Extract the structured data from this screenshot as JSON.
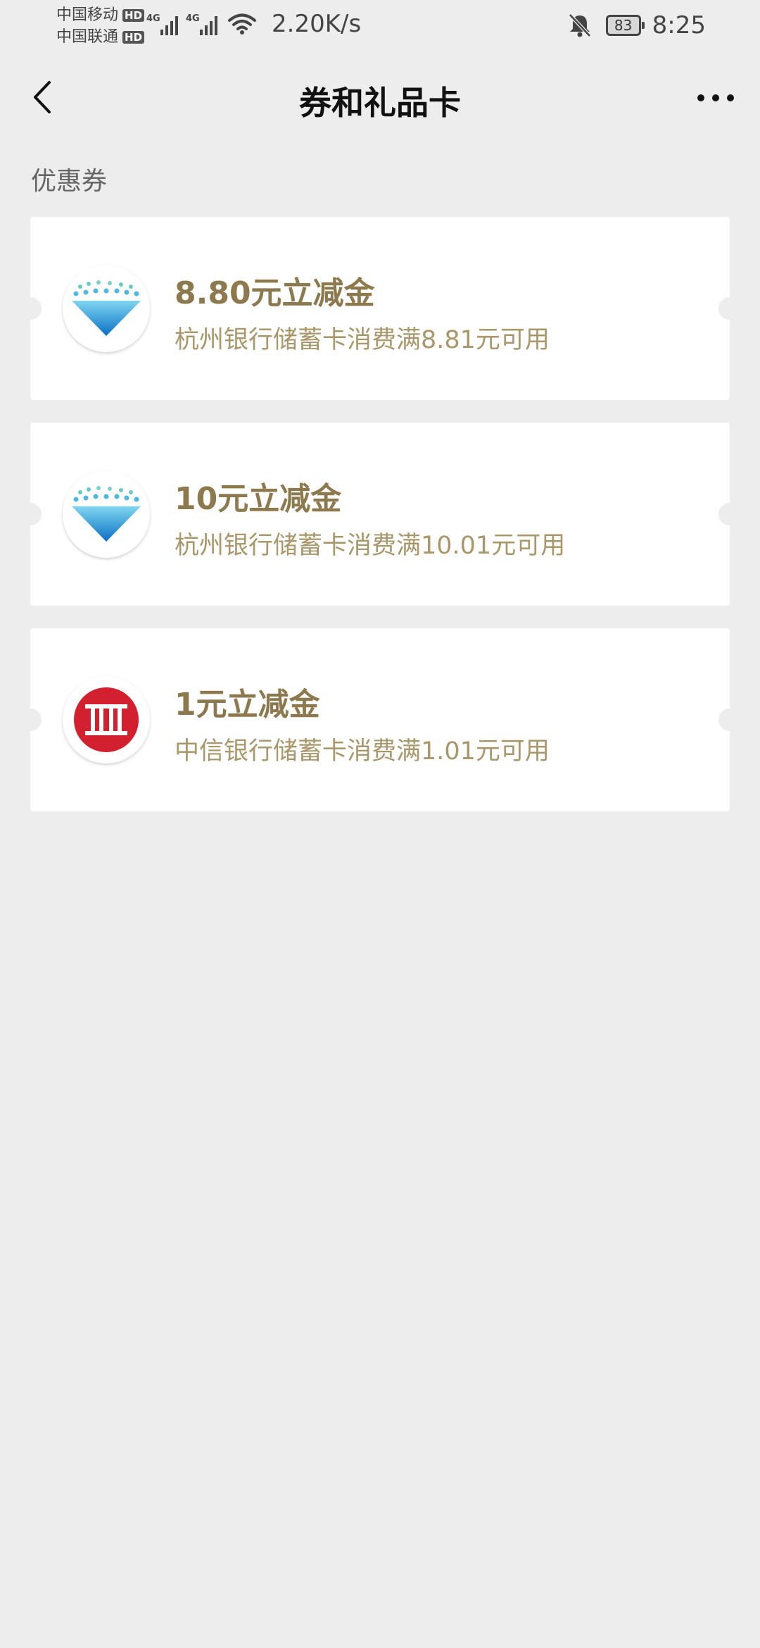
{
  "status_bar": {
    "carrier_1": "中国移动",
    "carrier_2": "中国联通",
    "hd_badge": "HD",
    "network_tag": "4G",
    "net_speed": "2.20K/s",
    "battery": "83",
    "time": "8:25"
  },
  "nav": {
    "title": "券和礼品卡",
    "back_icon": "chevron-left-icon",
    "more_icon": "more-dots-icon"
  },
  "section": {
    "label": "优惠券"
  },
  "coupons": [
    {
      "title": "8.80元立减金",
      "description": "杭州银行储蓄卡消费满8.81元可用",
      "logo": "hangzhou-bank-logo"
    },
    {
      "title": "10元立减金",
      "description": "杭州银行储蓄卡消费满10.01元可用",
      "logo": "hangzhou-bank-logo"
    },
    {
      "title": "1元立减金",
      "description": "中信银行储蓄卡消费满1.01元可用",
      "logo": "citic-bank-logo"
    }
  ],
  "colors": {
    "background": "#ededed",
    "card": "#ffffff",
    "title_gold": "#8c7a4e",
    "desc_gold": "#a8976b",
    "citic_red": "#d3202f",
    "hzbank_blue": "#1aa0d8"
  }
}
